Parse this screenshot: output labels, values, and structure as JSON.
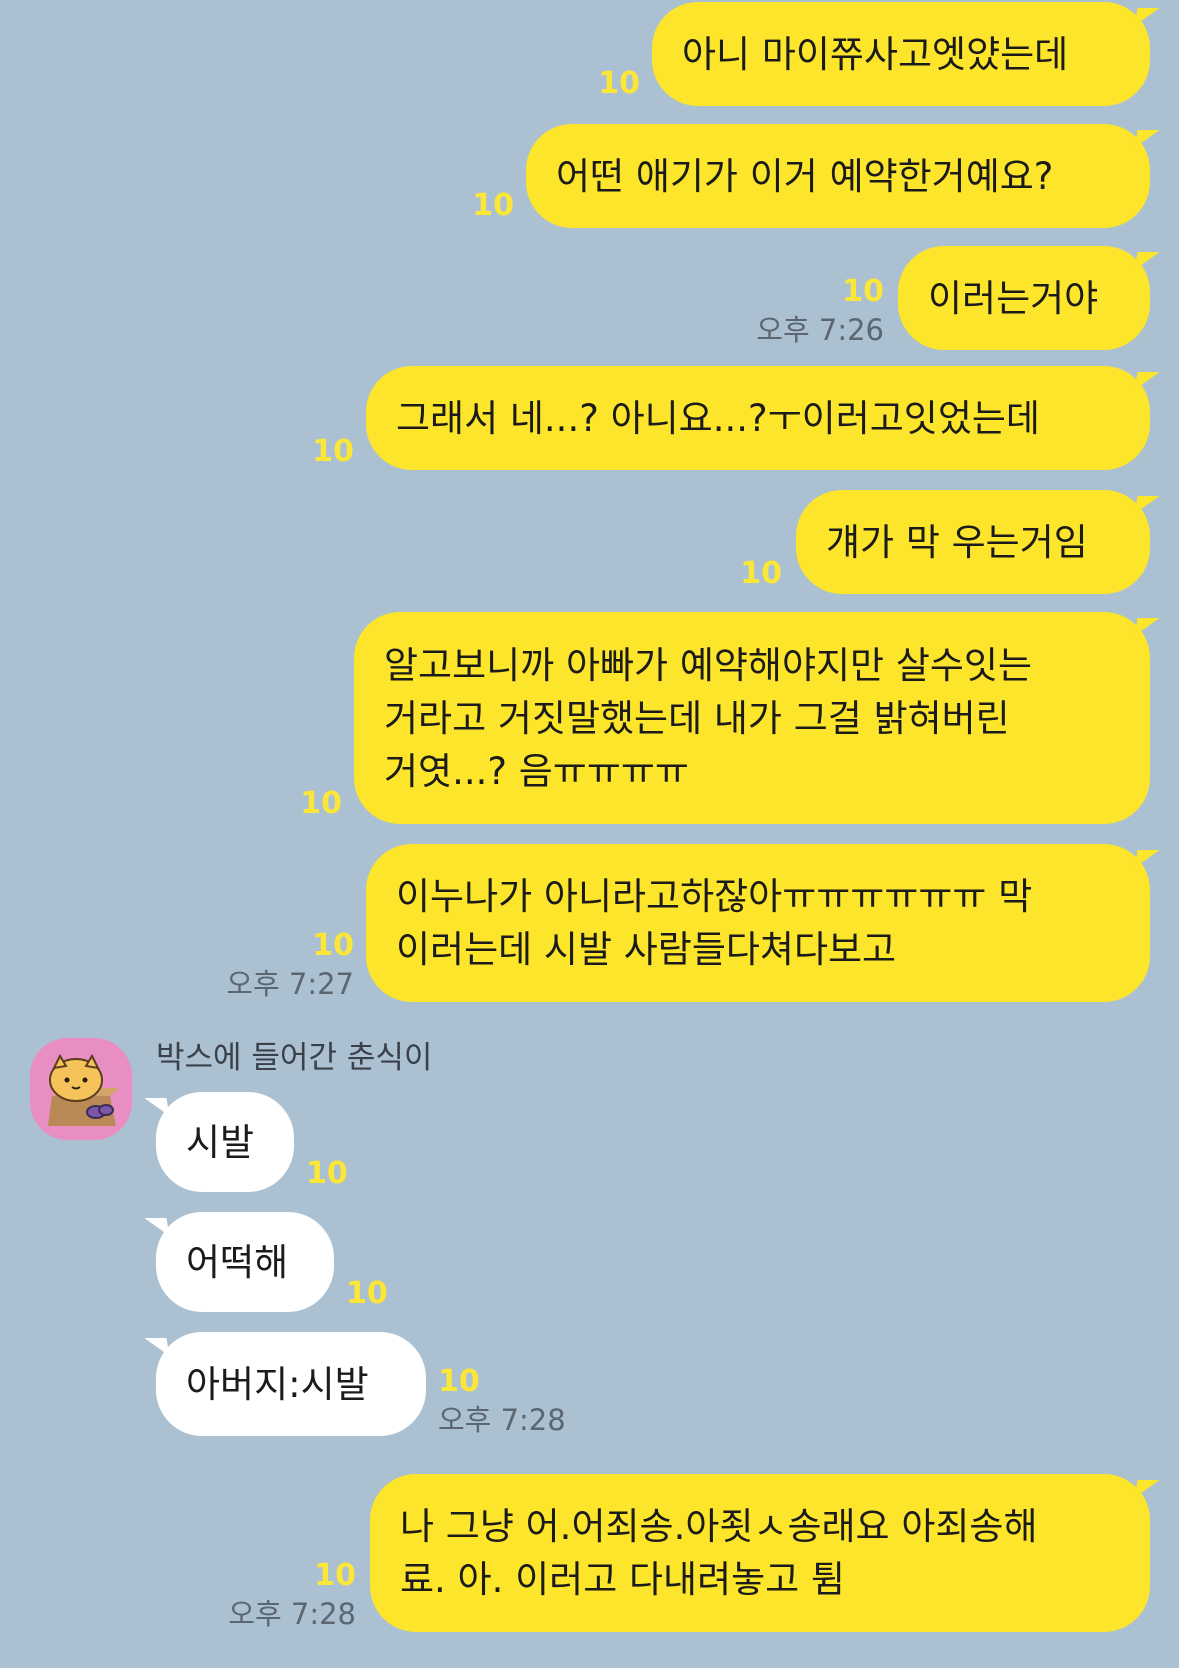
{
  "colors": {
    "background": "#abc1d1",
    "my_bubble": "#fde52b",
    "other_bubble": "#ffffff",
    "unread_count": "#fce638",
    "time_text": "#5c6670"
  },
  "chat": {
    "other_user": {
      "name": "박스에 들어간 춘식이",
      "avatar_icon": "chunsik-in-box-avatar"
    },
    "messages": [
      {
        "sender": "me",
        "text": "아니 마이쮸사고엣얐는데",
        "unread": "10"
      },
      {
        "sender": "me",
        "text": "어떤 애기가 이거 예약한거예요?",
        "unread": "10"
      },
      {
        "sender": "me",
        "text": "이러는거야",
        "unread": "10",
        "time": "오후 7:26"
      },
      {
        "sender": "me",
        "text": "그래서 네...? 아니요...?ㅜ이러고잇었는데",
        "unread": "10"
      },
      {
        "sender": "me",
        "text": "걔가 막 우는거임",
        "unread": "10"
      },
      {
        "sender": "me",
        "text": "알고보니까 아빠가 예약해야지만 살수잇는\n거라고 거짓말했는데 내가 그걸 밝혀버린\n거엿...? 음ㅠㅠㅠㅠ",
        "unread": "10"
      },
      {
        "sender": "me",
        "text": "이누나가 아니라고하잖아ㅠㅠㅠㅠㅠㅠ 막\n이러는데 시발 사람들다쳐다보고",
        "unread": "10",
        "time": "오후 7:27"
      },
      {
        "sender": "other",
        "text": "시발",
        "unread": "10"
      },
      {
        "sender": "other",
        "text": "어떡해",
        "unread": "10"
      },
      {
        "sender": "other",
        "text": "아버지:시발",
        "unread": "10",
        "time": "오후 7:28"
      },
      {
        "sender": "me",
        "text": "나 그냥 어.어죄송.아죗ㅅ송래요 아죄송해\n료. 아. 이러고 다내려놓고 튐",
        "unread": "10",
        "time": "오후 7:28"
      }
    ]
  }
}
